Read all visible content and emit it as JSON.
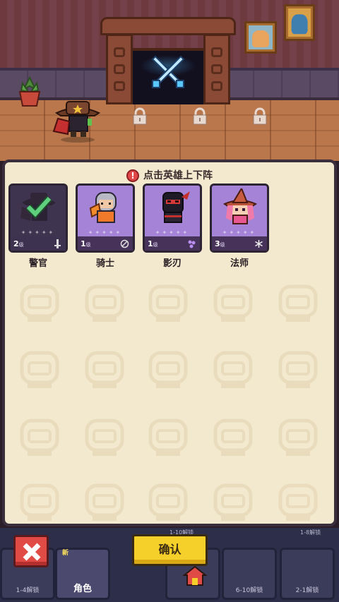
{
  "scene": {
    "portal_icon": "crossed-swords-icon",
    "locked_slots": 3,
    "hero_on_stage": "sheriff"
  },
  "panel": {
    "hint_icon": "alert-icon",
    "hint_text": "点击英雄上下阵",
    "heroes": [
      {
        "name": "警官",
        "level": "2",
        "level_suffix": "级",
        "trait_icon": "sword-icon",
        "selected": true
      },
      {
        "name": "骑士",
        "level": "1",
        "level_suffix": "级",
        "trait_icon": "shield-icon",
        "selected": false
      },
      {
        "name": "影刃",
        "level": "1",
        "level_suffix": "级",
        "trait_icon": "claw-icon",
        "selected": false
      },
      {
        "name": "法师",
        "level": "3",
        "level_suffix": "级",
        "trait_icon": "snowflake-icon",
        "selected": false
      }
    ]
  },
  "actions": {
    "close_icon": "close-icon",
    "confirm_label": "确认"
  },
  "bottom_nav": {
    "new_badge": "新",
    "items": [
      {
        "label": "1-4解锁"
      },
      {
        "label": "角色"
      },
      {
        "label": ""
      },
      {
        "label": "6-10解锁"
      },
      {
        "label": "2-1解锁"
      }
    ],
    "obscured_texts": [
      "1-10解锁",
      "1-8解锁"
    ]
  },
  "colors": {
    "panel_bg": "#f3e9cf",
    "card_purple": "#a583d6",
    "confirm_yellow": "#f6d02a",
    "close_red": "#e14b45"
  }
}
